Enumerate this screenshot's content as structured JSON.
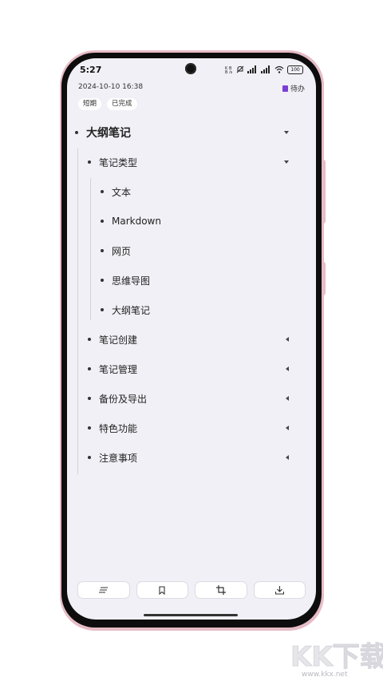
{
  "status_bar": {
    "time": "5:27",
    "battery": "100"
  },
  "note": {
    "date": "2024-10-10 16:38",
    "status": "待办",
    "tags": [
      "短期",
      "已完成"
    ]
  },
  "outline": {
    "root": "大纲笔记",
    "types_label": "笔记类型",
    "types": [
      "文本",
      "Markdown",
      "网页",
      "思维导图",
      "大纲笔记"
    ],
    "sections": [
      "笔记创建",
      "笔记管理",
      "备份及导出",
      "特色功能",
      "注意事项"
    ]
  },
  "toolbar": {
    "icons": [
      "align-icon",
      "bookmark-icon",
      "crop-icon",
      "download-icon"
    ]
  },
  "watermark": {
    "logo": "KK下载",
    "url": "www.kkx.net"
  },
  "colors": {
    "screen_bg": "#f1f0f6",
    "frame_pink": "#e6bcc6",
    "todo_purple": "#7b3fd6"
  }
}
